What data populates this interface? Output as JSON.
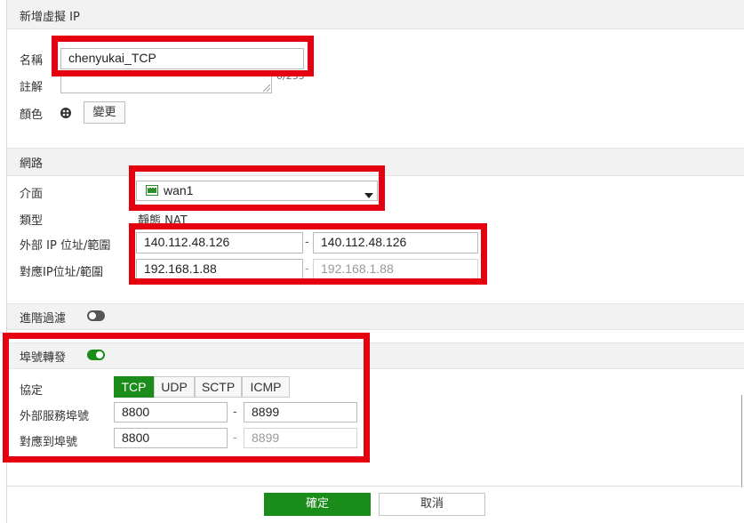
{
  "header": {
    "title": "新增虛擬 IP"
  },
  "general": {
    "name_label": "名稱",
    "name_value": "chenyukai_TCP",
    "comment_label": "註解",
    "comment_counter": "0/255",
    "color_label": "顏色",
    "color_button": "變更"
  },
  "network": {
    "section_title": "網路",
    "interface_label": "介面",
    "interface_value": "wan1",
    "type_label": "類型",
    "type_value": "靜態 NAT",
    "external_ip_label": "外部 IP 位址/範圍",
    "external_ip_start": "140.112.48.126",
    "external_ip_end": "140.112.48.126",
    "mapped_ip_label": "對應IP位址/範圍",
    "mapped_ip_start": "192.168.1.88",
    "mapped_ip_end": "192.168.1.88",
    "range_separator": "-"
  },
  "advanced": {
    "label": "進階過濾",
    "enabled": false
  },
  "port_forward": {
    "label": "埠號轉發",
    "enabled": true,
    "protocol_label": "協定",
    "protocols": [
      "TCP",
      "UDP",
      "SCTP",
      "ICMP"
    ],
    "selected_protocol": "TCP",
    "external_port_label": "外部服務埠號",
    "external_port_start": "8800",
    "external_port_end": "8899",
    "mapped_port_label": "對應到埠號",
    "mapped_port_start": "8800",
    "mapped_port_end": "8899",
    "range_separator": "-"
  },
  "footer": {
    "ok_label": "確定",
    "cancel_label": "取消"
  },
  "colors": {
    "accent_green": "#1a8c1a",
    "annotation_red": "#e4000f"
  }
}
